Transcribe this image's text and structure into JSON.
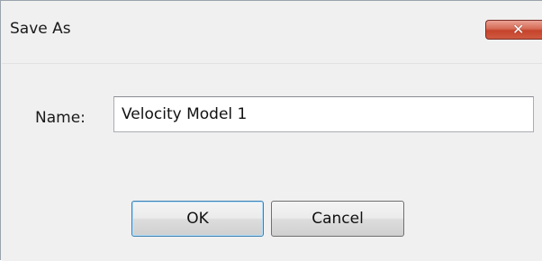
{
  "window": {
    "title": "Save As",
    "close_icon": "close-icon",
    "close_glyph": "✕"
  },
  "form": {
    "name_label": "Name:",
    "name_value": "Velocity Model 1"
  },
  "buttons": {
    "ok_label": "OK",
    "cancel_label": "Cancel"
  },
  "colors": {
    "close_button": "#c5432b",
    "default_button_border": "#3c7fb1"
  }
}
